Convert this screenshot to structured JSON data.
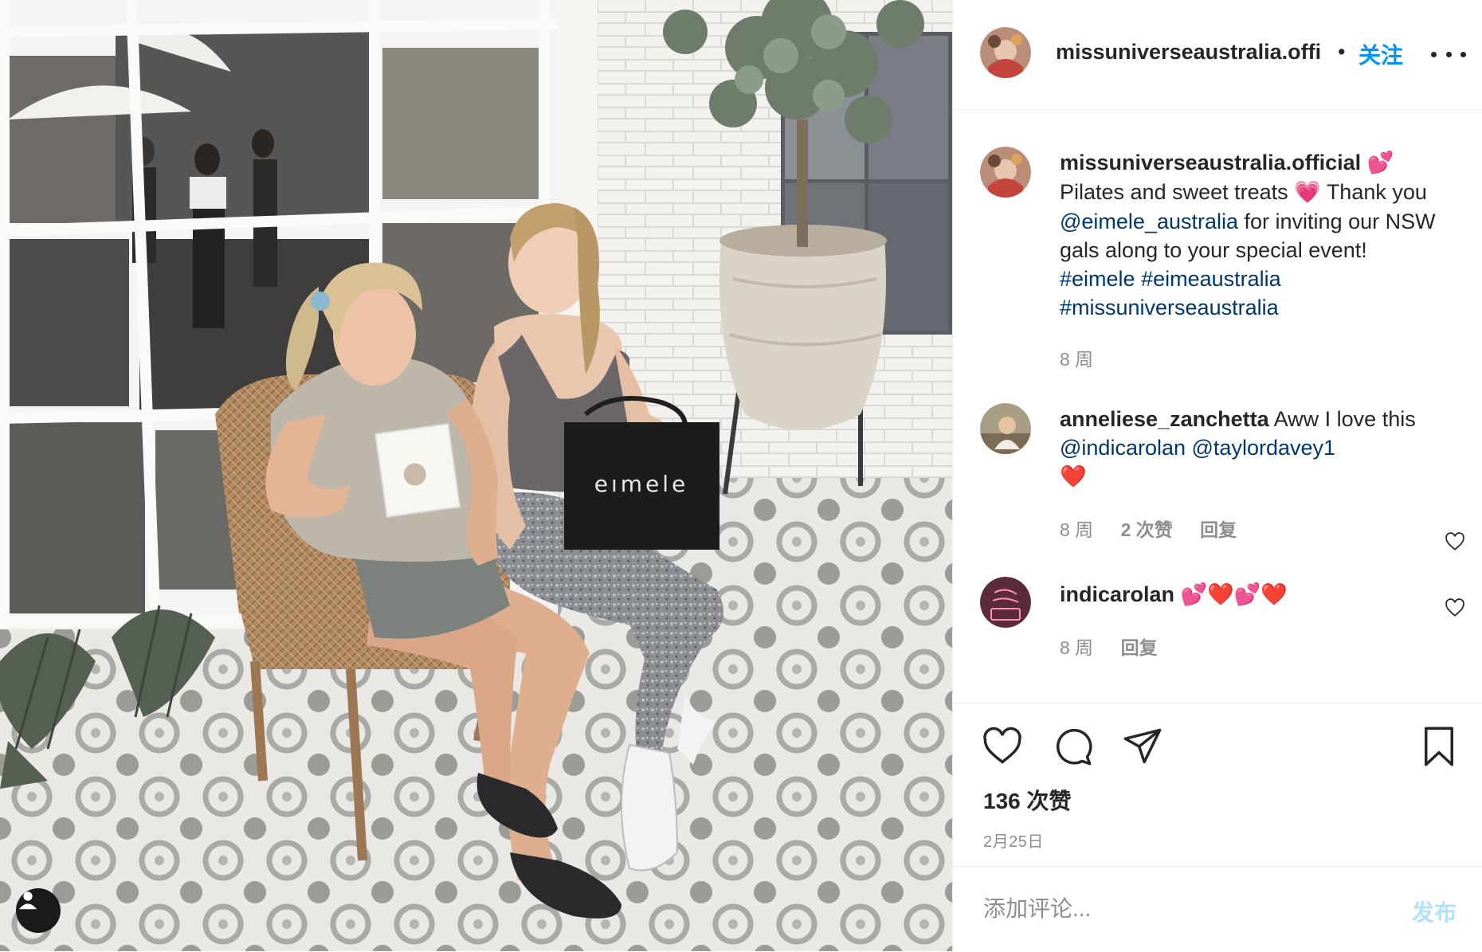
{
  "post": {
    "photo_bag_text": "eımele",
    "header": {
      "username": "missuniverseaustralia.offi",
      "separator": "•",
      "follow_label": "关注"
    },
    "caption": {
      "username": "missuniverseaustralia.official",
      "emoji_after_name": "💕",
      "line1_a": "Pilates and sweet treats",
      "emoji_mid": "💗",
      "line1_b": "Thank you",
      "mention": "@eimele_australia",
      "text_after_mention": "for inviting our NSW gals along to your special event!",
      "hashtag1": "#eimele",
      "hashtag2": "#eimeaustralia",
      "hashtag3": "#missuniverseaustralia",
      "time": "8 周"
    },
    "comments": [
      {
        "username": "anneliese_zanchetta",
        "text": "Aww I love this",
        "mention1": "@indicarolan",
        "mention2": "@taylordavey1",
        "emoji": "❤️",
        "time": "8 周",
        "likes": "2 次赞",
        "reply": "回复"
      },
      {
        "username": "indicarolan",
        "emojis": "💕❤️💕❤️",
        "time": "8 周",
        "reply": "回复"
      }
    ],
    "actions": {
      "likes_count": "136 次赞",
      "date": "2月25日"
    },
    "add_comment": {
      "placeholder": "添加评论...",
      "post_label": "发布"
    }
  },
  "icons": {
    "like": "heart-icon",
    "comment": "comment-icon",
    "share": "paper-plane-icon",
    "save": "bookmark-icon",
    "more": "more-options-icon",
    "tagged": "user-tag-icon"
  },
  "colors": {
    "link_blue": "#0095f6",
    "mention_blue": "#00376b",
    "muted": "#8e8e8e",
    "post_disabled": "#b2dffc"
  }
}
